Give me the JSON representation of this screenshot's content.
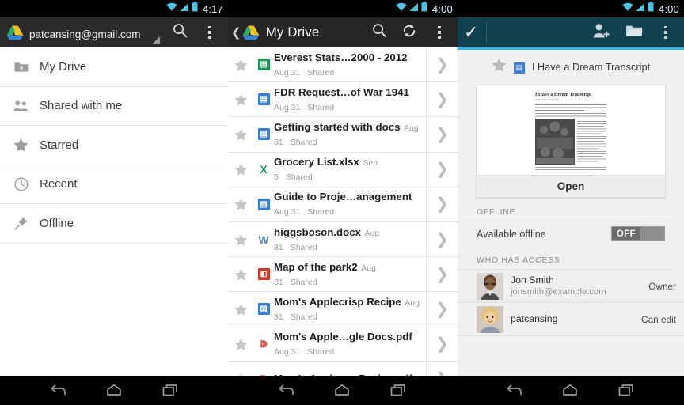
{
  "panels": {
    "left": {
      "status": {
        "time": "4:17",
        "wifi_icon": "wifi-icon",
        "signal_icon": "signal-icon",
        "battery_icon": "battery-icon"
      },
      "actionbar": {
        "logo_icon": "google-drive-logo-icon",
        "account": "patcansing@gmail.com",
        "caret_icon": "dropdown-caret-icon",
        "search_icon": "search-icon",
        "overflow_icon": "overflow-menu-icon"
      },
      "nav_items": [
        {
          "label": "My Drive",
          "icon": "folder-icon"
        },
        {
          "label": "Shared with me",
          "icon": "people-icon"
        },
        {
          "label": "Starred",
          "icon": "star-icon"
        },
        {
          "label": "Recent",
          "icon": "clock-icon"
        },
        {
          "label": "Offline",
          "icon": "pin-icon"
        }
      ]
    },
    "middle": {
      "status": {
        "time": "4:00",
        "wifi_icon": "wifi-icon",
        "signal_icon": "signal-icon",
        "battery_icon": "battery-icon"
      },
      "actionbar": {
        "back_icon": "back-chevron-icon",
        "logo_icon": "google-drive-logo-icon",
        "title": "My Drive",
        "search_icon": "search-icon",
        "refresh_icon": "refresh-icon",
        "overflow_icon": "overflow-menu-icon"
      },
      "files": [
        {
          "name": "Everest Stats…2000 - 2012",
          "date": "Aug 31",
          "shared": "Shared",
          "type": "sheets",
          "glyph": "▤",
          "color": "#1a9a52",
          "star_icon": "star-icon",
          "chevron_icon": "chevron-right-icon"
        },
        {
          "name": "FDR Request…of War 1941",
          "date": "Aug 31",
          "shared": "Shared",
          "type": "docs",
          "glyph": "▤",
          "color": "#3b7fd4",
          "star_icon": "star-icon",
          "chevron_icon": "chevron-right-icon"
        },
        {
          "name": "Getting started with docs",
          "date": "Aug 31",
          "shared": "Shared",
          "type": "docs",
          "glyph": "▤",
          "color": "#3b7fd4",
          "star_icon": "star-icon",
          "chevron_icon": "chevron-right-icon"
        },
        {
          "name": "Grocery List.xlsx",
          "date": "Sep 5",
          "shared": "Shared",
          "type": "excel",
          "glyph": "X",
          "color": "#1f9c66",
          "star_icon": "star-icon",
          "chevron_icon": "chevron-right-icon"
        },
        {
          "name": "Guide to Proje…anagement",
          "date": "Aug 31",
          "shared": "Shared",
          "type": "docs",
          "glyph": "▤",
          "color": "#3b7fd4",
          "star_icon": "star-icon",
          "chevron_icon": "chevron-right-icon"
        },
        {
          "name": "higgsboson.docx",
          "date": "Aug 31",
          "shared": "Shared",
          "type": "word",
          "glyph": "W",
          "color": "#5b83c4",
          "star_icon": "star-icon",
          "chevron_icon": "chevron-right-icon"
        },
        {
          "name": "Map of the park2",
          "date": "Aug 31",
          "shared": "Shared",
          "type": "powerpoint",
          "glyph": "◨",
          "color": "#c73e2b",
          "star_icon": "star-icon",
          "chevron_icon": "chevron-right-icon"
        },
        {
          "name": "Mom's Applecrisp Recipe",
          "date": "Aug 31",
          "shared": "Shared",
          "type": "docs",
          "glyph": "▤",
          "color": "#3b7fd4",
          "star_icon": "star-icon",
          "chevron_icon": "chevron-right-icon"
        },
        {
          "name": "Mom's Apple…gle Docs.pdf",
          "date": "Aug 31",
          "shared": "Shared",
          "type": "pdf",
          "glyph": "⅄",
          "color": "#d9544d",
          "star_icon": "star-icon",
          "chevron_icon": "chevron-right-icon"
        },
        {
          "name": "Mom's Apple…p Recipe.pdf",
          "date": "",
          "shared": "",
          "type": "pdf",
          "glyph": "⅄",
          "color": "#d9544d",
          "star_icon": "star-icon",
          "chevron_icon": "chevron-right-icon"
        }
      ]
    },
    "right": {
      "status": {
        "time": "4:00",
        "wifi_icon": "wifi-icon",
        "signal_icon": "signal-icon",
        "battery_icon": "battery-icon"
      },
      "actionbar": {
        "done_icon": "checkmark-icon",
        "add_person_icon": "add-person-icon",
        "folder_icon": "folder-icon",
        "overflow_icon": "overflow-menu-icon",
        "accent_color": "#39b4e0",
        "bar_color": "#11404f"
      },
      "document": {
        "title": "I Have a Dream Transcript",
        "star_icon": "star-icon",
        "type_icon": "docs-file-icon",
        "thumbnail_title": "I Have a Dream Transcript",
        "open_label": "Open"
      },
      "offline": {
        "section_title": "OFFLINE",
        "row_label": "Available offline",
        "toggle_value": "OFF"
      },
      "access": {
        "section_title": "WHO HAS ACCESS",
        "people": [
          {
            "name": "Jon Smith",
            "email": "jonsmith@example.com",
            "role": "Owner",
            "avatar": "avatar-jon-smith"
          },
          {
            "name": "patcansing",
            "email": "",
            "role": "Can edit",
            "avatar": "avatar-patcansing"
          }
        ]
      }
    }
  },
  "navbar": {
    "back_icon": "back-icon",
    "home_icon": "home-icon",
    "recents_icon": "recents-icon"
  }
}
